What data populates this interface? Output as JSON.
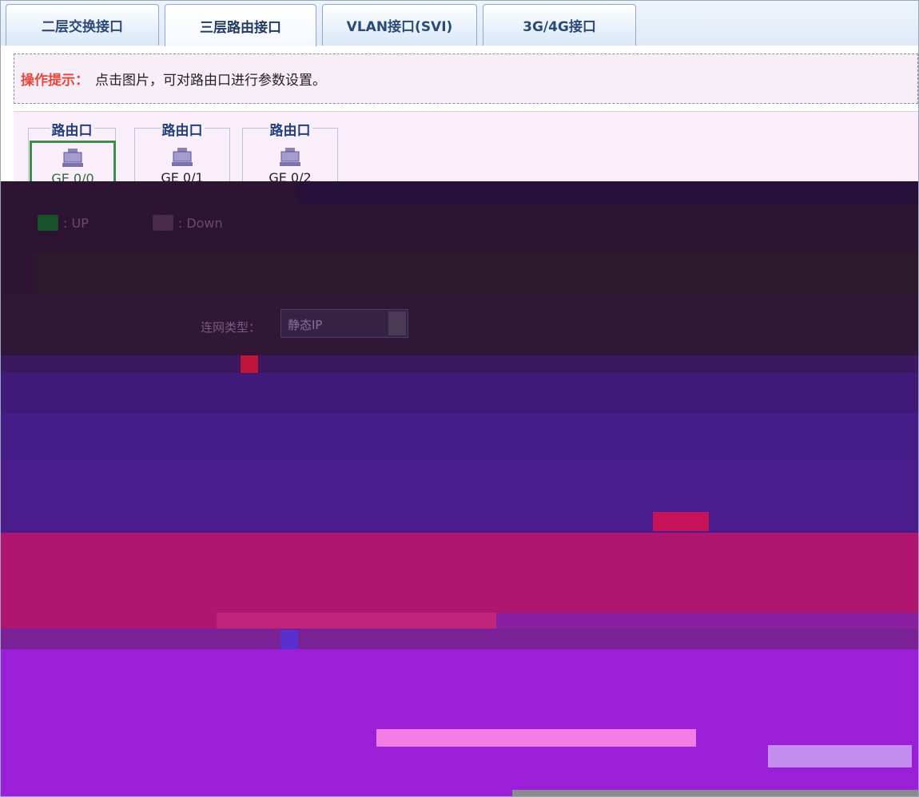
{
  "tabs": [
    {
      "label": "二层交换接口",
      "active": false
    },
    {
      "label": "三层路由接口",
      "active": true
    },
    {
      "label": "VLAN接口(SVI)",
      "active": false
    },
    {
      "label": "3G/4G接口",
      "active": false
    }
  ],
  "hint": {
    "label": "操作提示：",
    "text": "点击图片，可对路由口进行参数设置。"
  },
  "ports": [
    {
      "group": "路由口",
      "name": "GE 0/0",
      "selected": true
    },
    {
      "group": "路由口",
      "name": "GE 0/1",
      "selected": false
    },
    {
      "group": "路由口",
      "name": "GE 0/2",
      "selected": false
    }
  ],
  "legend": {
    "up_label": ": UP",
    "down_label": ": Down"
  },
  "form": {
    "conn_type_label": "连网类型：",
    "conn_type_value": "静态IP"
  },
  "colors": {
    "tab_text": "#2b4a78",
    "hint_label": "#e4483c",
    "selected_border": "#3e8d4d",
    "port_icon": "#8c82b8"
  }
}
